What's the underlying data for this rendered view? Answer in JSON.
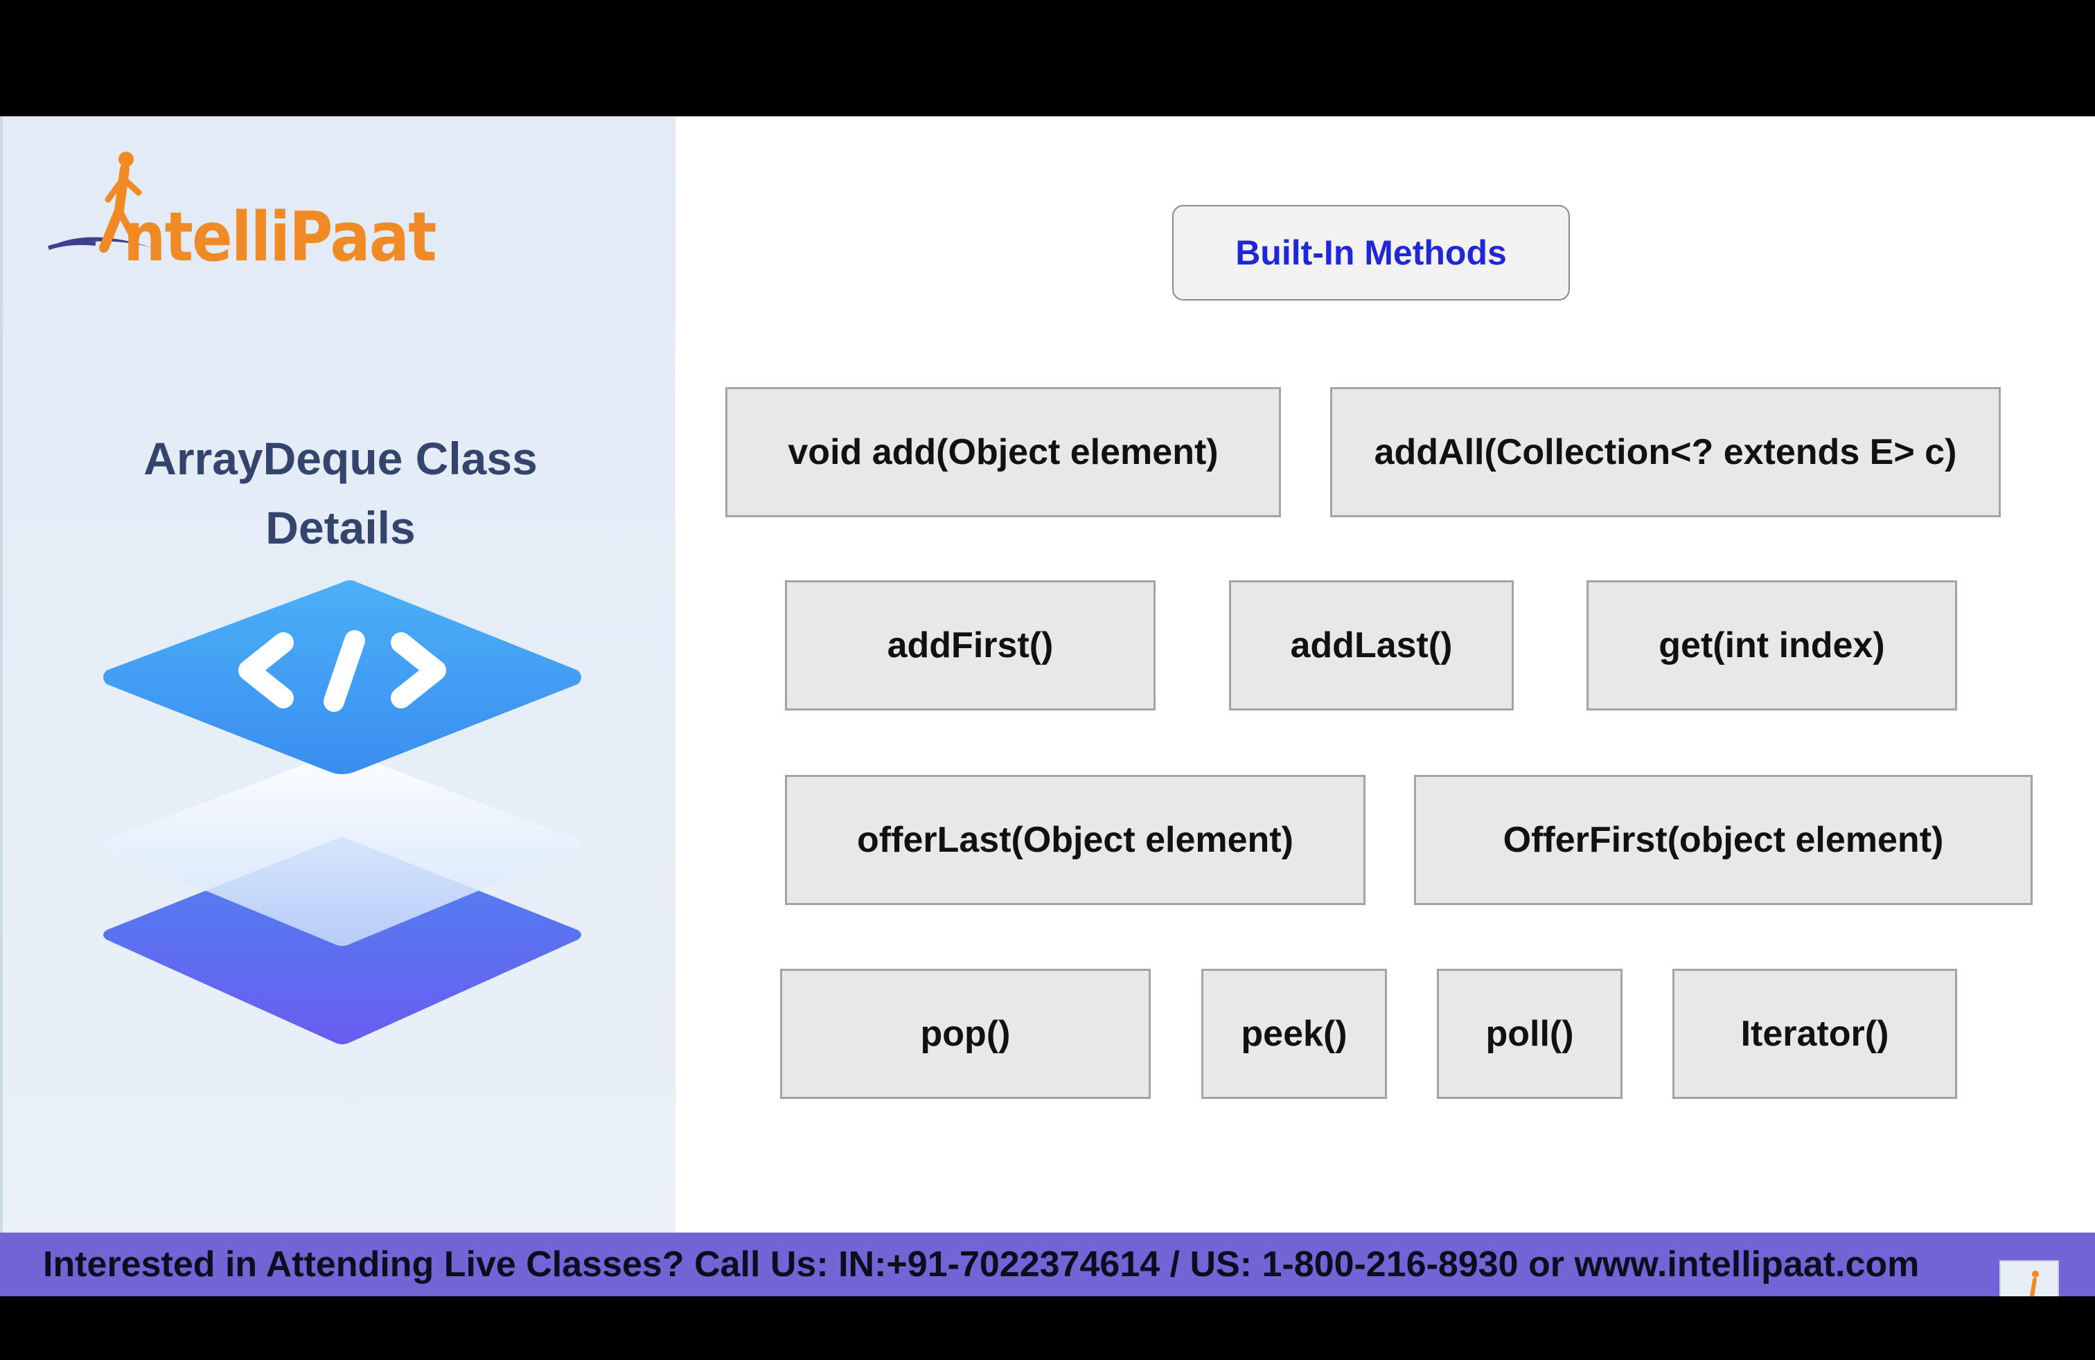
{
  "logo": {
    "text": "ntelliPaat",
    "mark": "I"
  },
  "sidebar": {
    "title_line1": "ArrayDeque Class",
    "title_line2": "Details",
    "icon": "code-layers-icon"
  },
  "header": {
    "label": "Built-In Methods"
  },
  "methods": [
    "void add(Object element)",
    "addAll(Collection<? extends E> c)",
    "addFirst()",
    "addLast()",
    "get(int index)",
    "offerLast(Object element)",
    "OfferFirst(object element)",
    "pop()",
    "peek()",
    "poll()",
    "Iterator()"
  ],
  "footer": {
    "text": "Interested in Attending Live Classes? Call Us: IN:+91-7022374614 / US: 1-800-216-8930 or www.intellipaat.com"
  },
  "colors": {
    "accent": "#1f27d6",
    "brand_orange": "#f08a24",
    "footer_bg": "#7264d4",
    "title": "#34456d"
  }
}
